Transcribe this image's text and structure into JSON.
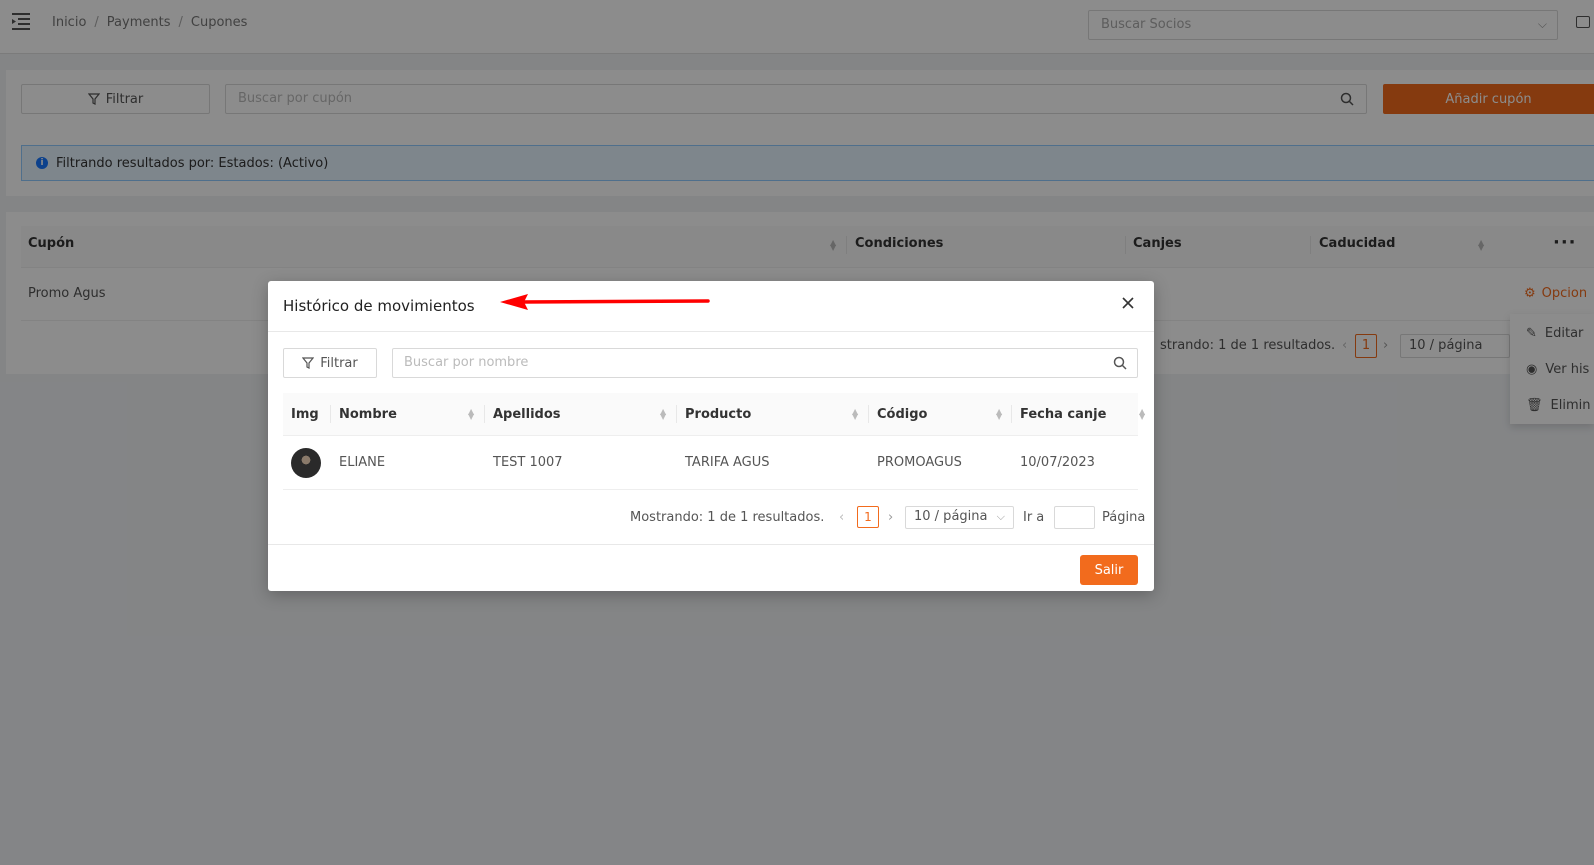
{
  "breadcrumb": [
    "Inicio",
    "Payments",
    "Cupones"
  ],
  "topbar": {
    "socios_placeholder": "Buscar Socios"
  },
  "toolbar": {
    "filter_label": "Filtrar",
    "search_placeholder": "Buscar por cupón",
    "add_label": "Añadir cupón"
  },
  "alert": {
    "text": "Filtrando resultados por: Estados: (Activo)"
  },
  "coupons_table": {
    "columns": [
      "Cupón",
      "Condiciones",
      "Canjes",
      "Caducidad"
    ],
    "rows": [
      {
        "cupon": "Promo Agus"
      }
    ],
    "options_label": "Opcion",
    "pagination_text": "strando: 1 de 1 resultados.",
    "page": "1",
    "page_size": "10 / página"
  },
  "row_menu": {
    "items": [
      "Editar",
      "Ver his",
      "Elimin"
    ]
  },
  "modal": {
    "title": "Histórico de movimientos",
    "filter_label": "Filtrar",
    "search_placeholder": "Buscar por nombre",
    "columns": [
      "Img",
      "Nombre",
      "Apellidos",
      "Producto",
      "Código",
      "Fecha canje"
    ],
    "rows": [
      {
        "nombre": "ELIANE",
        "apellidos": "TEST 1007",
        "producto": "TARIFA AGUS",
        "codigo": "PROMOAGUS",
        "fecha": "10/07/2023"
      }
    ],
    "pagination": {
      "summary": "Mostrando: 1 de 1 resultados.",
      "page": "1",
      "page_size": "10 / página",
      "goto_label": "Ir a",
      "page_label": "Página"
    },
    "exit_label": "Salir"
  },
  "colors": {
    "accent": "#f26b1d",
    "info": "#1677ff",
    "arrow": "#ff0000"
  }
}
